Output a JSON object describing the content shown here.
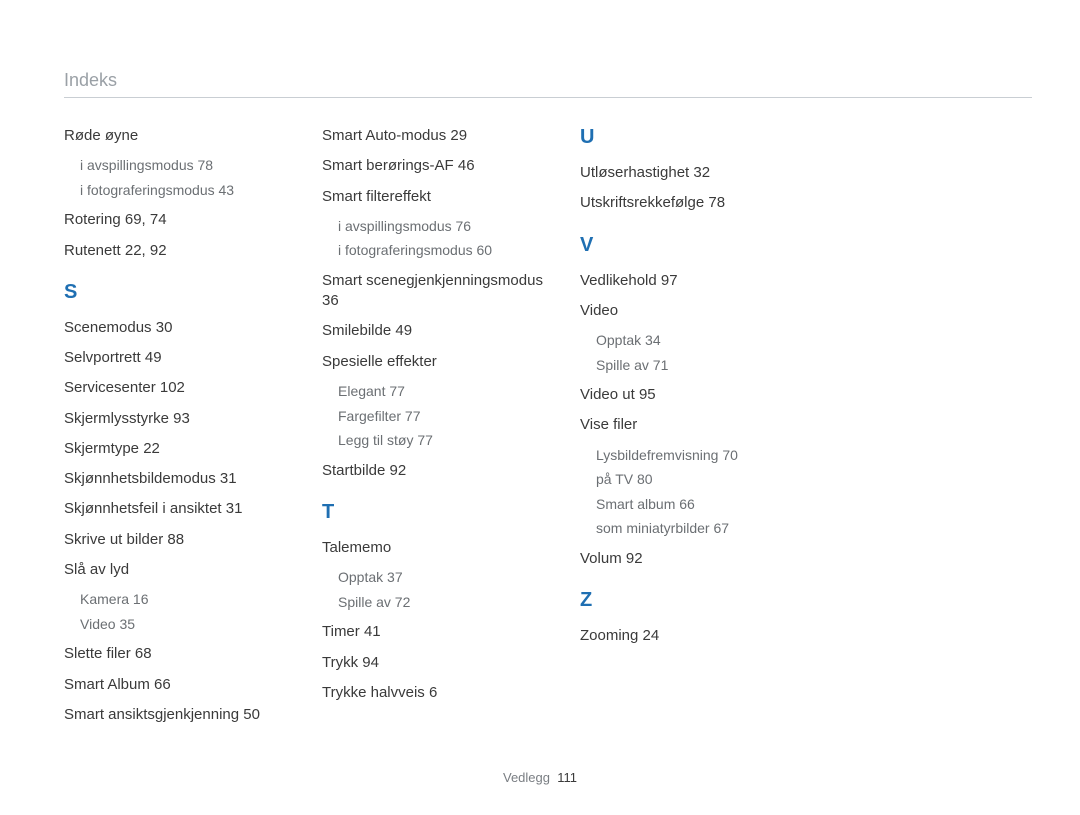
{
  "header": "Indeks",
  "footer": {
    "label": "Vedlegg",
    "page": "111"
  },
  "col1": {
    "rode_oyne": "Røde øyne",
    "rode_sub1": "i avspillingsmodus  78",
    "rode_sub2": "i fotograferingsmodus  43",
    "rotering": "Rotering  69, 74",
    "rutenett": "Rutenett  22, 92",
    "letter_S": "S",
    "scenemodus": "Scenemodus  30",
    "selvportrett": "Selvportrett  49",
    "servicesenter": "Servicesenter  102",
    "skjermlysstyrke": "Skjermlysstyrke  93",
    "skjermtype": "Skjermtype  22",
    "skjonnhetsbildemodus": "Skjønnhetsbildemodus  31",
    "skjonnhetsfeil": "Skjønnhetsfeil i ansiktet  31",
    "skrive_ut_bilder": "Skrive ut bilder  88",
    "sla_av_lyd": "Slå av lyd",
    "sla_sub1": "Kamera  16",
    "sla_sub2": "Video  35",
    "slette_filer": "Slette filer  68",
    "smart_album": "Smart Album  66",
    "smart_ansiktsgjenkjenning": "Smart ansiktsgjenkjenning  50"
  },
  "col2": {
    "smart_auto": "Smart Auto-modus  29",
    "smart_berorings": "Smart berørings-AF  46",
    "smart_filtereffekt": "Smart filtereffekt",
    "sfe_sub1": "i avspillingsmodus  76",
    "sfe_sub2": "i fotograferingsmodus  60",
    "smart_scene": "Smart scenegjenkjenningsmodus  36",
    "smilebilde": "Smilebilde  49",
    "spesielle_effekter": "Spesielle effekter",
    "sp_sub1": "Elegant  77",
    "sp_sub2": "Fargefilter  77",
    "sp_sub3": "Legg til støy  77",
    "startbilde": "Startbilde  92",
    "letter_T": "T",
    "talememo": "Talememo",
    "tm_sub1": "Opptak  37",
    "tm_sub2": "Spille av  72",
    "timer": "Timer  41",
    "trykk": "Trykk  94",
    "trykke_halvveis": "Trykke halvveis  6"
  },
  "col3": {
    "letter_U": "U",
    "utloserhastighet": "Utløserhastighet  32",
    "utskriftsrekkefolge": "Utskriftsrekkefølge  78",
    "letter_V": "V",
    "vedlikehold": "Vedlikehold  97",
    "video": "Video",
    "video_sub1": "Opptak  34",
    "video_sub2": "Spille av  71",
    "video_ut": "Video ut  95",
    "vise_filer": "Vise filer",
    "vf_sub1": "Lysbildefremvisning  70",
    "vf_sub2": "på TV  80",
    "vf_sub3": "Smart album  66",
    "vf_sub4": "som miniatyrbilder  67",
    "volum": "Volum  92",
    "letter_Z": "Z",
    "zooming": "Zooming  24"
  }
}
